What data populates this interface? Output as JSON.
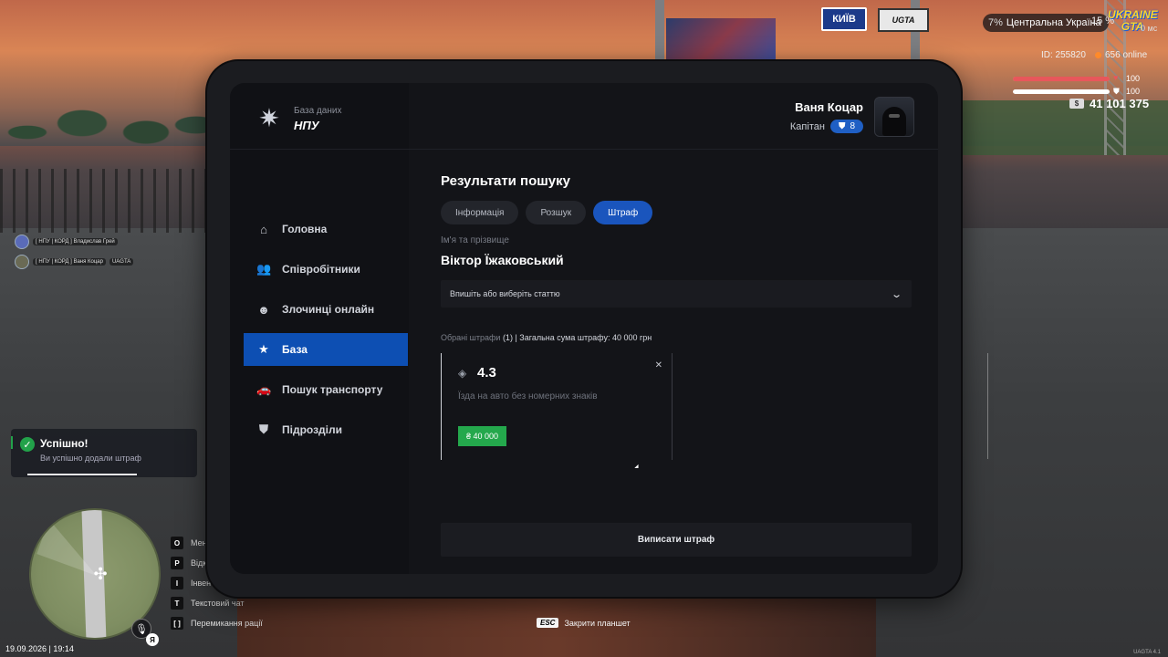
{
  "hud": {
    "region_left_pct": "7%",
    "region_name": "Центральна Україна",
    "region_right_pct": "15 %",
    "brand_logo_text": "UKRAINE GTA",
    "ping": "0 мс",
    "player_id": "ID: 255820",
    "online": "656 online",
    "health": {
      "label": "100",
      "value": 100,
      "color": "#e8575b"
    },
    "armor": {
      "label": "100",
      "value": 100,
      "color": "#ffffff"
    },
    "money": "41 101 375",
    "sign_kyiv": "КИЇВ"
  },
  "voice_chat": [
    {
      "text": "[ НПУ | КОРД ] Владислав Грей"
    },
    {
      "text": "[ НПУ | КОРД ] Ваня Коцар",
      "badge": "UAGTA"
    }
  ],
  "toast": {
    "title": "Успішно!",
    "text": "Ви успішно додали штраф",
    "progress": 0.6,
    "color": "#22a24a"
  },
  "datetime": "19.09.2026 | 19:14",
  "lang": "Я",
  "keys": [
    {
      "key": "O",
      "label": "Мені"
    },
    {
      "key": "P",
      "label": "Відк"
    },
    {
      "key": "I",
      "label": "Інвент"
    },
    {
      "key": "T",
      "label": "Текстовий чат"
    },
    {
      "key": "[  ]",
      "label": "Перемикання рації"
    }
  ],
  "esc_hint": {
    "key": "ESC",
    "label": "Закрити планшет"
  },
  "build": "UAGTA 4.1",
  "tablet": {
    "brand": {
      "subtitle": "База даних",
      "title": "НПУ"
    },
    "user": {
      "name": "Ваня Коцар",
      "rank": "Капітан",
      "level": "8"
    },
    "nav": [
      {
        "label": "Головна",
        "icon": "home-icon",
        "active": false
      },
      {
        "label": "Співробітники",
        "icon": "users-icon",
        "active": false
      },
      {
        "label": "Злочинці онлайн",
        "icon": "criminal-icon",
        "active": false
      },
      {
        "label": "База",
        "icon": "star-icon",
        "active": true
      },
      {
        "label": "Пошук транспорту",
        "icon": "car-icon",
        "active": false
      },
      {
        "label": "Підрозділи",
        "icon": "shield-icon",
        "active": false
      }
    ],
    "page_title": "Результати пошуку",
    "tabs": [
      {
        "label": "Інформація",
        "active": false
      },
      {
        "label": "Розшук",
        "active": false
      },
      {
        "label": "Штраф",
        "active": true
      }
    ],
    "field_label": "Ім'я та прізвище",
    "person_name": "Віктор Їжаковський",
    "select_placeholder": "Впишіть або виберіть статтю",
    "summary": {
      "prefix": "Обрані штрафи",
      "count": "(1)",
      "total": "| Загальна сума штрафу: 40 000 грн"
    },
    "fines": [
      {
        "code": "4.3",
        "description": "Їзда на авто без номерних знаків",
        "amount": "₴ 40 000"
      }
    ],
    "submit_label": "Виписати штраф"
  }
}
